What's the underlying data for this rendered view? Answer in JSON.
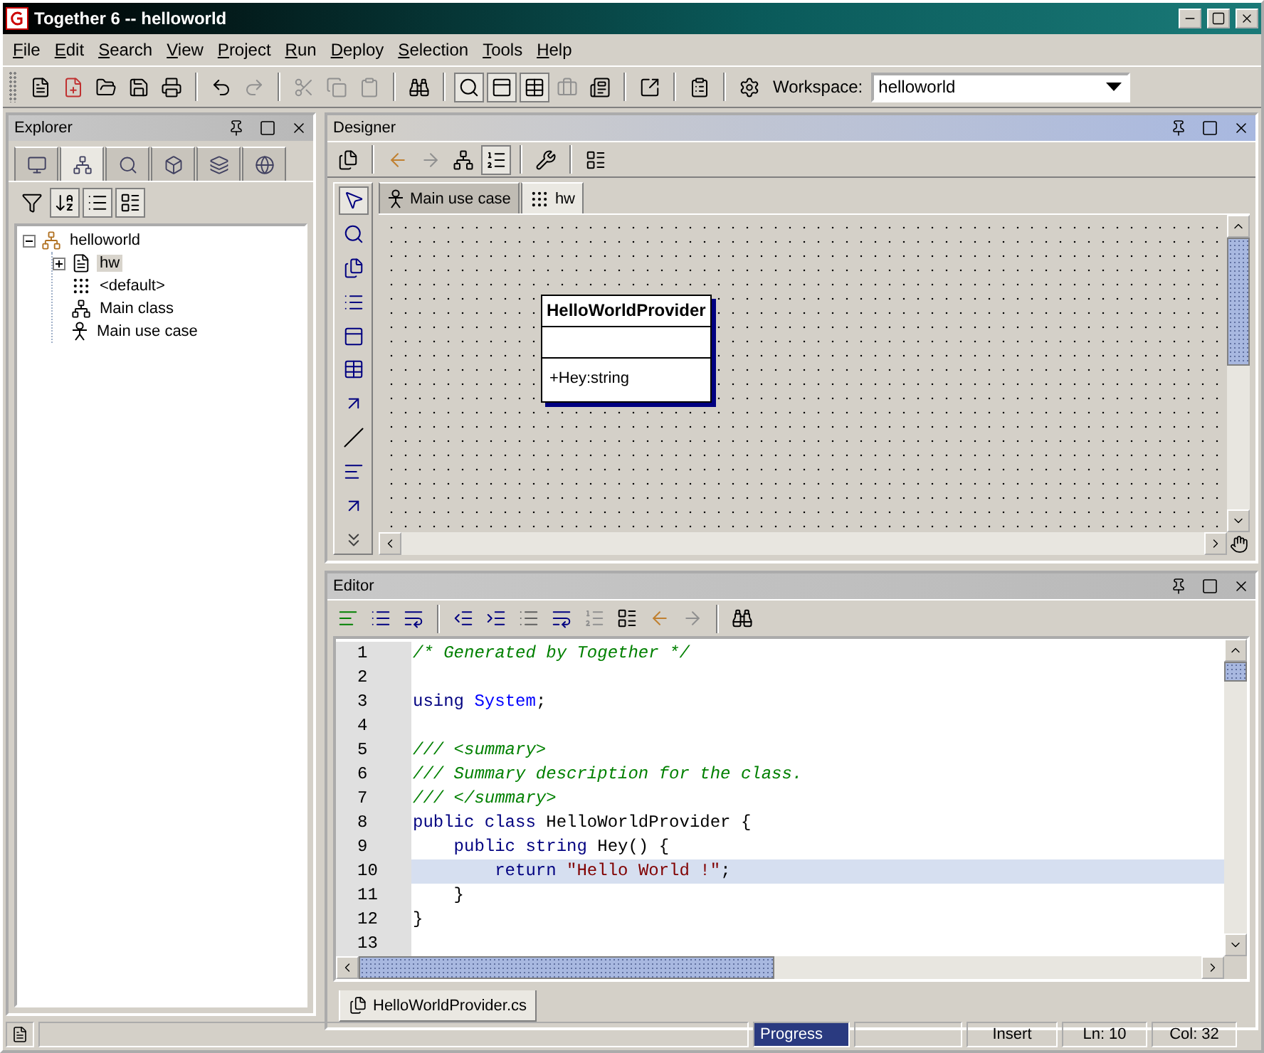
{
  "window": {
    "title": "Together 6 -- helloworld"
  },
  "menu": [
    "File",
    "Edit",
    "Search",
    "View",
    "Project",
    "Run",
    "Deploy",
    "Selection",
    "Tools",
    "Help"
  ],
  "toolbar": {
    "workspace_label": "Workspace:",
    "workspace_value": "helloworld"
  },
  "explorer": {
    "title": "Explorer",
    "tabs": [
      {
        "selected": false
      },
      {
        "selected": true
      },
      {
        "selected": false
      },
      {
        "selected": false
      },
      {
        "selected": false
      },
      {
        "selected": false
      }
    ],
    "tree": [
      {
        "label": "helloworld",
        "kind": "project",
        "expanded": true,
        "selected": false,
        "children": [
          {
            "label": "hw",
            "kind": "document",
            "expanded": false,
            "selected": true
          },
          {
            "label": "<default>",
            "kind": "package",
            "selected": false
          },
          {
            "label": "Main class",
            "kind": "class-diagram",
            "selected": false
          },
          {
            "label": "Main use case",
            "kind": "use-case",
            "selected": false
          }
        ]
      }
    ]
  },
  "designer": {
    "title": "Designer",
    "tabs": [
      {
        "label": "Main use case",
        "kind": "use-case",
        "selected": false
      },
      {
        "label": "hw",
        "kind": "package",
        "selected": true
      }
    ],
    "class_box": {
      "name": "HelloWorldProvider",
      "operations": [
        "+Hey:string"
      ]
    }
  },
  "editor": {
    "title": "Editor",
    "lines": [
      {
        "number": "1",
        "current": false,
        "tokens": [
          {
            "kind": "comment",
            "text": "/* Generated by Together */"
          }
        ]
      },
      {
        "number": "2",
        "current": false
      },
      {
        "number": "3",
        "current": false,
        "tokens": [
          {
            "kind": "keyword",
            "text": "using "
          },
          {
            "kind": "type",
            "text": "System"
          },
          {
            "kind": "plain",
            "text": ";"
          }
        ]
      },
      {
        "number": "4",
        "current": false
      },
      {
        "number": "5",
        "current": false,
        "tokens": [
          {
            "kind": "comment",
            "text": "/// <summary>"
          }
        ]
      },
      {
        "number": "6",
        "current": false,
        "tokens": [
          {
            "kind": "comment",
            "text": "/// Summary description for the class."
          }
        ]
      },
      {
        "number": "7",
        "current": false,
        "tokens": [
          {
            "kind": "comment",
            "text": "/// </summary>"
          }
        ]
      },
      {
        "number": "8",
        "current": false,
        "tokens": [
          {
            "kind": "keyword",
            "text": "public class "
          },
          {
            "kind": "plain",
            "text": "HelloWorldProvider {"
          }
        ]
      },
      {
        "number": "9",
        "current": false,
        "tokens": [
          {
            "kind": "keyword",
            "text": "    public string "
          },
          {
            "kind": "plain",
            "text": "Hey() {"
          }
        ]
      },
      {
        "number": "10",
        "current": true,
        "tokens": [
          {
            "kind": "keyword",
            "text": "        return "
          },
          {
            "kind": "string",
            "text": "\"Hello World !\""
          },
          {
            "kind": "plain",
            "text": ";"
          }
        ]
      },
      {
        "number": "11",
        "current": false,
        "tokens": [
          {
            "kind": "plain",
            "text": "    }"
          }
        ]
      },
      {
        "number": "12",
        "current": false,
        "tokens": [
          {
            "kind": "plain",
            "text": "}"
          }
        ]
      },
      {
        "number": "13",
        "current": false
      }
    ],
    "file_tabs": [
      {
        "label": "HelloWorldProvider.cs",
        "selected": true
      }
    ]
  },
  "status_bar": {
    "progress": "Progress",
    "mode": "Insert",
    "line": "Ln: 10",
    "column": "Col: 32"
  }
}
